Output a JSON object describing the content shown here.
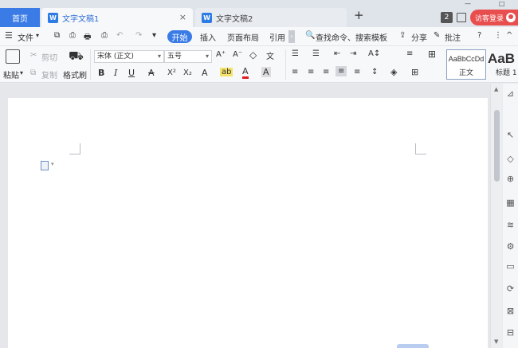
{
  "tabs": {
    "home": "首页",
    "active_doc": "文字文稿1",
    "inactive_doc": "文字文稿2",
    "new_tab": "+",
    "close_glyph": "×",
    "doc_icon_letter": "W"
  },
  "window": {
    "minimize": "—",
    "maximize": "□",
    "count_badge": "2",
    "guest_login": "访客登录"
  },
  "menubar": {
    "menu_icon": "☰",
    "file": "文件",
    "file_caret": "▾",
    "start": "开始",
    "insert": "插入",
    "page_layout": "页面布局",
    "reference": "引用",
    "more_chevron": "›",
    "search_icon": "🔍",
    "search": "查找命令、搜索模板",
    "share_icon": "⇪",
    "share": "分享",
    "comment_icon": "✎",
    "comment": "批注",
    "help": "?",
    "more_dots": "⋮",
    "collapse": "^",
    "quick_tools": [
      "⧉",
      "⎙",
      "🖶",
      "↶",
      "↷",
      "▾"
    ]
  },
  "ribbon": {
    "paste": "粘贴",
    "paste_caret": "▾",
    "cut": "剪切",
    "copy": "复制",
    "format_painter": "格式刷",
    "font_name": "宋体 (正文)",
    "font_size": "五号",
    "grow_font": "A⁺",
    "shrink_font": "A⁻",
    "clear_format": "◇",
    "pinyin": "文",
    "bold": "B",
    "italic": "I",
    "underline": "U",
    "strikethrough": "A",
    "superscript": "X²",
    "subscript": "X₂",
    "text_effect": "A",
    "highlight": "ab",
    "font_color": "A",
    "char_shading": "A",
    "bullets": "☰",
    "numbering": "☰",
    "outdent": "⇤",
    "indent": "⇥",
    "text_direction": "A↕",
    "line_spacing": "≡",
    "borders": "⊞",
    "align_left": "≡",
    "align_center": "≡",
    "align_right": "≡",
    "justify": "≡",
    "distributed": "≡",
    "paragraph_spacing": "↕",
    "shading": "◈",
    "table_border": "⊞",
    "style_normal_sample": "AaBbCcDd",
    "style_normal_label": "正文",
    "style_heading_sample": "AaB",
    "style_heading_label": "标题 1"
  },
  "side_tools": [
    "⊿",
    "↖",
    "◇",
    "⊕",
    "▦",
    "≋",
    "⚙",
    "▭",
    "⟳",
    "⊠",
    "⊟"
  ],
  "colors": {
    "accent": "#3a7be6",
    "guest": "#e84e4e"
  }
}
